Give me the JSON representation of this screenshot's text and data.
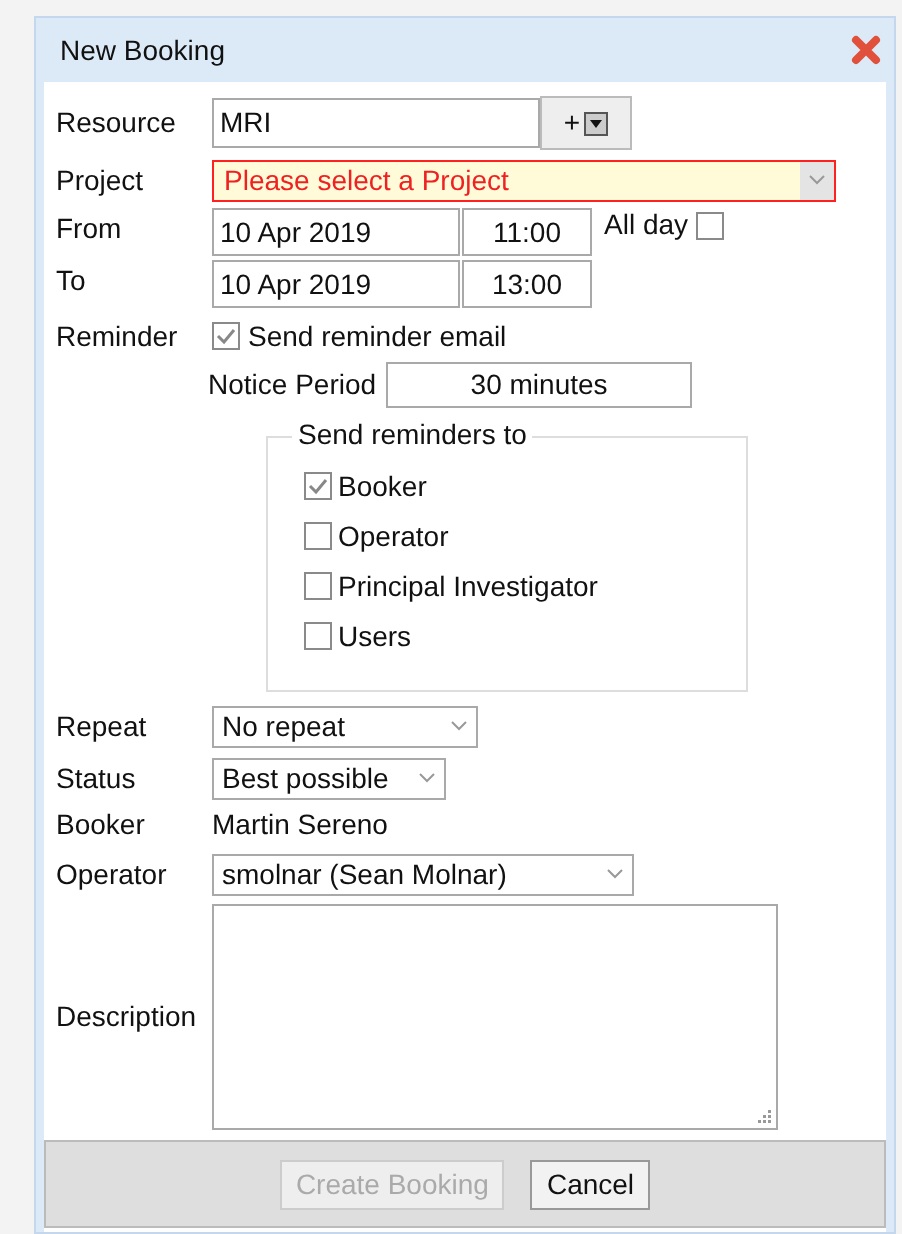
{
  "dialog": {
    "title": "New Booking"
  },
  "resource": {
    "label": "Resource",
    "value": "MRI",
    "add_button": "+"
  },
  "project": {
    "label": "Project",
    "value": "Please select a Project",
    "invalid": true
  },
  "from": {
    "label": "From",
    "date": "10 Apr 2019",
    "time": "11:00"
  },
  "to": {
    "label": "To",
    "date": "10 Apr 2019",
    "time": "13:00"
  },
  "all_day": {
    "label": "All day",
    "checked": false
  },
  "reminder": {
    "label": "Reminder",
    "send_email": {
      "label": "Send reminder email",
      "checked": true
    },
    "notice_label": "Notice Period",
    "notice_value": "30 minutes",
    "recipients_title": "Send reminders to",
    "recipients": [
      {
        "label": "Booker",
        "checked": true
      },
      {
        "label": "Operator",
        "checked": false
      },
      {
        "label": "Principal Investigator",
        "checked": false
      },
      {
        "label": "Users",
        "checked": false
      }
    ]
  },
  "repeat": {
    "label": "Repeat",
    "value": "No repeat"
  },
  "status": {
    "label": "Status",
    "value": "Best possible"
  },
  "booker": {
    "label": "Booker",
    "value": "Martin Sereno"
  },
  "operator": {
    "label": "Operator",
    "value": "smolnar (Sean Molnar)"
  },
  "description": {
    "label": "Description"
  },
  "buttons": [
    {
      "label": "Create Booking",
      "disabled": true
    },
    {
      "label": "Cancel",
      "disabled": false
    }
  ]
}
